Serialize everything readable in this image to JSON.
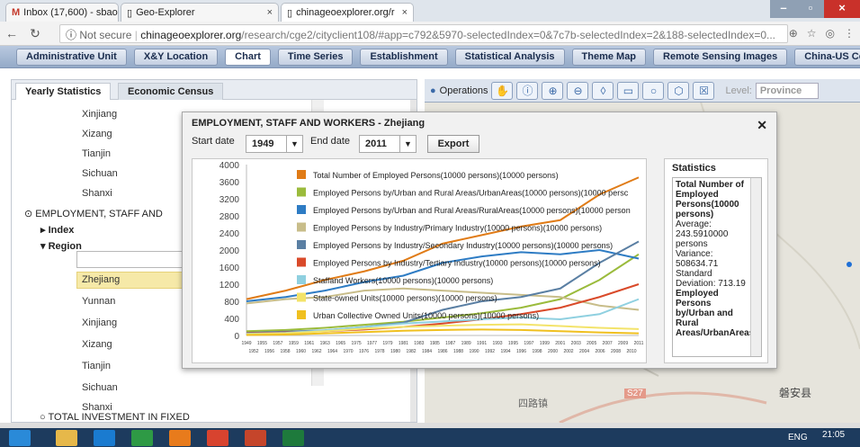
{
  "browser": {
    "tabs": [
      {
        "label": "Inbox (17,600) - sbao@",
        "close": "×"
      },
      {
        "label": "Geo-Explorer",
        "close": "×"
      },
      {
        "label": "chinageoexplorer.org/r",
        "close": "×"
      }
    ],
    "security": "Not secure",
    "url_host": "chinageoexplorer.org",
    "url_path": "/research/cge2/cityclient108/#app=c792&5970-selectedIndex=0&7c7b-selectedIndex=2&188-selectedIndex=0..."
  },
  "menubar": [
    "Administrative Unit",
    "X&Y Location",
    "Chart",
    "Time Series",
    "Establishment",
    "Statistical Analysis",
    "Theme Map",
    "Remote Sensing Images",
    "China-US Compare"
  ],
  "left": {
    "tabs": [
      "Yearly Statistics",
      "Economic Census"
    ],
    "top_regions": [
      "Xinjiang",
      "Xizang",
      "Tianjin",
      "Sichuan",
      "Shanxi"
    ],
    "category": "EMPLOYMENT, STAFF AND",
    "index_label": "Index",
    "region_label": "Region",
    "regions": [
      "Zhejiang",
      "Yunnan",
      "Xinjiang",
      "Xizang",
      "Tianjin",
      "Sichuan",
      "Shanxi"
    ],
    "bottom_category": "TOTAL INVESTMENT IN FIXED"
  },
  "map": {
    "operations": "Operations",
    "level_label": "Level:",
    "level_value": "Province",
    "labels": [
      "四路镇",
      "S27",
      "磐安县"
    ]
  },
  "dialog": {
    "title": "EMPLOYMENT, STAFF AND WORKERS - Zhejiang",
    "start_label": "Start date",
    "start_value": "1949",
    "end_label": "End date",
    "end_value": "2011",
    "export": "Export",
    "stats_title": "Statistics",
    "stats": [
      "Total Number of Employed Persons(10000 persons)",
      "Average:",
      "243.5910000",
      "persons",
      "Variance:",
      "508634.71",
      "Standard",
      "Deviation: 713.19",
      "Employed Persons by/Urban and Rural Areas/UrbanAreas(10000"
    ]
  },
  "chart_data": {
    "type": "line",
    "yticks": [
      0,
      400,
      800,
      1200,
      1600,
      2000,
      2400,
      2800,
      3200,
      3600,
      4000
    ],
    "ylim": [
      0,
      4000
    ],
    "x_row1": [
      "1949",
      "1955",
      "1957",
      "1959",
      "1961",
      "1963",
      "1965",
      "1975",
      "1977",
      "1979",
      "1981",
      "1983",
      "1985",
      "1987",
      "1989",
      "1991",
      "1993",
      "1995",
      "1997",
      "1999",
      "2001",
      "2003",
      "2005",
      "2007",
      "2009",
      "2011"
    ],
    "x_row2": [
      "1952",
      "1956",
      "1958",
      "1960",
      "1962",
      "1964",
      "1970",
      "1976",
      "1978",
      "1980",
      "1982",
      "1984",
      "1986",
      "1988",
      "1990",
      "1992",
      "1994",
      "1996",
      "1998",
      "2000",
      "2002",
      "2004",
      "2006",
      "2008",
      "2010"
    ],
    "x": [
      "1949",
      "1955",
      "1965",
      "1975",
      "1980",
      "1985",
      "1990",
      "1995",
      "2000",
      "2005",
      "2011"
    ],
    "series": [
      {
        "name": "Total Number of Employed Persons(10000 persons)(10000 persons)",
        "color": "#e07b16",
        "values": [
          850,
          1050,
          1300,
          1500,
          1750,
          2150,
          2350,
          2550,
          2700,
          3300,
          3700
        ]
      },
      {
        "name": "Employed Persons by/Urban and Rural Areas/UrbanAreas(10000 persons)(10000 persc",
        "color": "#9bbb3c",
        "values": [
          100,
          130,
          180,
          250,
          320,
          420,
          520,
          650,
          850,
          1300,
          1900
        ]
      },
      {
        "name": "Employed Persons by/Urban and Rural Areas/RuralAreas(10000 persons)(10000 person",
        "color": "#2e7cc4",
        "values": [
          800,
          900,
          1050,
          1250,
          1400,
          1700,
          1850,
          1950,
          1900,
          2000,
          1800
        ]
      },
      {
        "name": "Employed Persons by Industry/Primary Industry(10000 persons)(10000 persons)",
        "color": "#c8bd8a",
        "values": [
          750,
          850,
          900,
          1050,
          1100,
          1050,
          1000,
          950,
          900,
          700,
          600
        ]
      },
      {
        "name": "Employed Persons by Industry/Secondary Industry(10000 persons)(10000 persons)",
        "color": "#5a7fa3",
        "values": [
          60,
          90,
          120,
          200,
          300,
          600,
          800,
          900,
          1100,
          1700,
          2200
        ]
      },
      {
        "name": "Employed Persons by Industry/Tertiary Industry(10000 persons)(10000 persons)",
        "color": "#d94a2a",
        "values": [
          50,
          70,
          100,
          140,
          200,
          280,
          380,
          500,
          650,
          900,
          1200
        ]
      },
      {
        "name": "Staffand Workers(10000 persons)(10000 persons)",
        "color": "#8fd0e0",
        "values": [
          40,
          60,
          120,
          200,
          280,
          330,
          380,
          420,
          380,
          500,
          850
        ]
      },
      {
        "name": "State-owned Units(10000 persons)(10000 persons)",
        "color": "#f3e36a",
        "values": [
          30,
          50,
          100,
          160,
          200,
          230,
          250,
          260,
          220,
          180,
          150
        ]
      },
      {
        "name": "Urban Collective Owned Units(10000 persons)(10000 persons)",
        "color": "#f0c020",
        "values": [
          10,
          20,
          50,
          80,
          110,
          130,
          140,
          130,
          100,
          70,
          50
        ]
      }
    ]
  },
  "taskbar": {
    "lang": "ENG",
    "time": "21:05"
  }
}
